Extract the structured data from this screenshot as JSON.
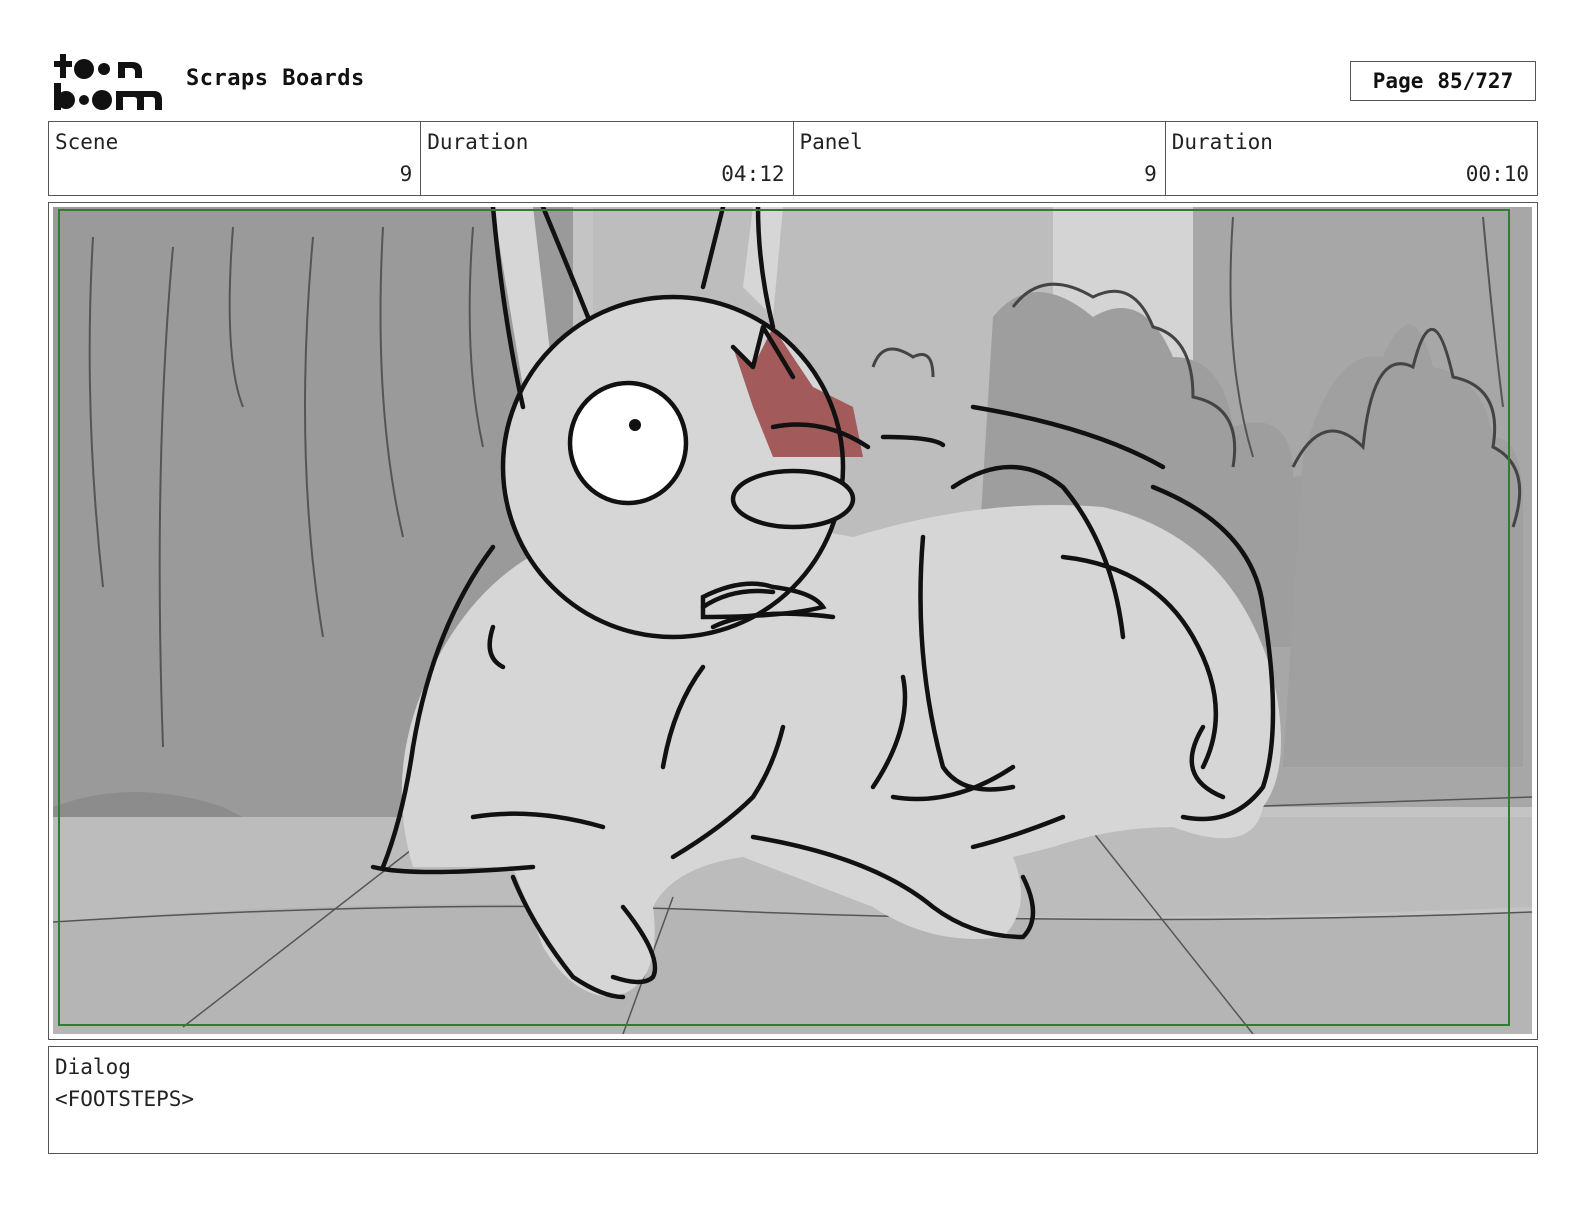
{
  "header": {
    "logo_text": "toon boom",
    "project_title": "Scraps Boards",
    "page_label": "Page",
    "page_value": "85/727"
  },
  "info": {
    "scene_label": "Scene",
    "scene_value": "9",
    "scene_duration_label": "Duration",
    "scene_duration_value": "04:12",
    "panel_label": "Panel",
    "panel_value": "9",
    "panel_duration_label": "Duration",
    "panel_duration_value": "00:10"
  },
  "dialog": {
    "label": "Dialog",
    "text": "<FOOTSTEPS>"
  },
  "colors": {
    "safe_frame": "#2e7d32",
    "mouth": "#a35a5a",
    "character_fill": "#d6d6d6",
    "background_tree": "#9a9a9a",
    "floor": "#b8b8b8"
  }
}
